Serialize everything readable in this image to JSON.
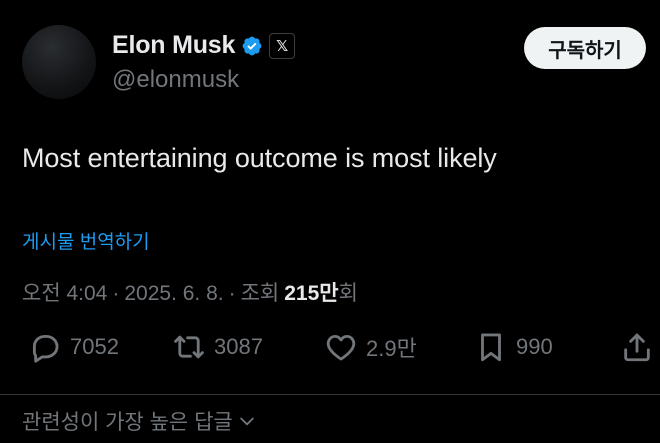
{
  "author": {
    "name": "Elon Musk",
    "handle": "@elonmusk",
    "x_badge": "𝕏"
  },
  "subscribe_label": "구독하기",
  "tweet_text": "Most entertaining outcome is most likely",
  "translate_label": "게시물 번역하기",
  "meta": {
    "time": "오전 4:04",
    "sep1": "·",
    "date": "2025. 6. 8.",
    "sep2": "·",
    "views_label": "조회",
    "views_number": "215만",
    "views_suffix": "회"
  },
  "actions": {
    "replies": "7052",
    "reposts": "3087",
    "likes": "2.9만",
    "bookmarks": "990"
  },
  "replies_sort_label": "관련성이 가장 높은 답글",
  "colors": {
    "background": "#000000",
    "text": "#e7e9ea",
    "muted": "#71767b",
    "accent": "#1d9bf0",
    "button_bg": "#eff3f4"
  },
  "icons": [
    "verified-badge-icon",
    "x-logo-icon",
    "reply-icon",
    "repost-icon",
    "like-icon",
    "bookmark-icon",
    "share-icon",
    "chevron-down-icon"
  ]
}
